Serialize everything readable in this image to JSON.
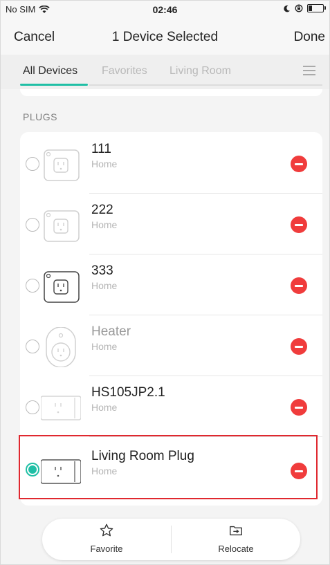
{
  "status_bar": {
    "carrier": "No SIM",
    "time": "02:46"
  },
  "nav": {
    "cancel": "Cancel",
    "title": "1 Device Selected",
    "done": "Done"
  },
  "tabs": [
    {
      "label": "All Devices",
      "active": true
    },
    {
      "label": "Favorites",
      "active": false
    },
    {
      "label": "Living Room",
      "active": false
    }
  ],
  "section_title": "PLUGS",
  "devices": [
    {
      "name": "111",
      "location": "Home",
      "selected": false,
      "thumb": "square-plug-icon"
    },
    {
      "name": "222",
      "location": "Home",
      "selected": false,
      "thumb": "square-plug-icon"
    },
    {
      "name": "333",
      "location": "Home",
      "selected": false,
      "thumb": "square-plug-icon"
    },
    {
      "name": "Heater",
      "location": "Home",
      "selected": false,
      "thumb": "round-plug-icon"
    },
    {
      "name": "HS105JP2.1",
      "location": "Home",
      "selected": false,
      "thumb": "slim-plug-icon"
    },
    {
      "name": "Living Room Plug",
      "location": "Home",
      "selected": true,
      "thumb": "slim-plug-icon"
    }
  ],
  "toolbar": {
    "favorite": "Favorite",
    "relocate": "Relocate"
  },
  "colors": {
    "accent": "#1fbfa5",
    "remove": "#f03c3c",
    "highlight": "#e0282f"
  }
}
